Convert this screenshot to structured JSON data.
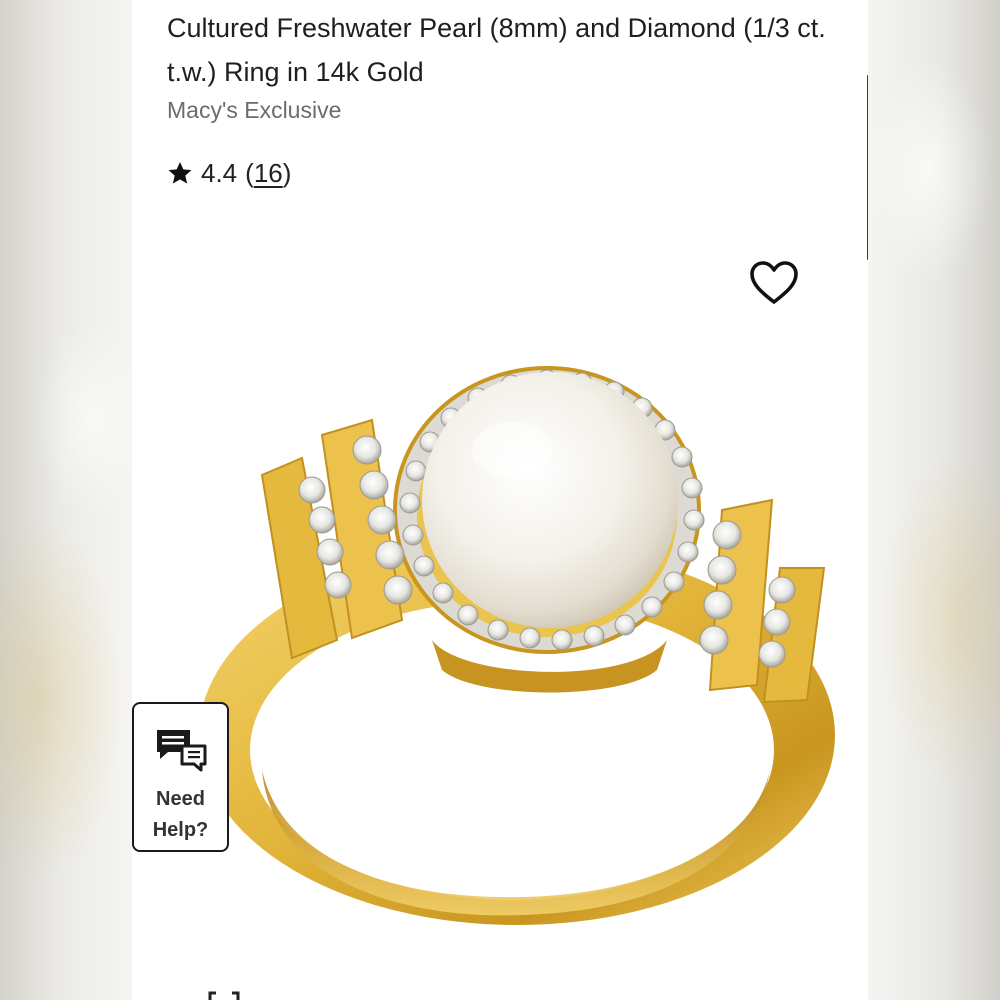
{
  "product": {
    "title": "Cultured Freshwater Pearl (8mm) and Diamond (1/3 ct. t.w.) Ring in 14k Gold",
    "brand": "Macy's Exclusive",
    "rating": {
      "value": "4.4",
      "count": "16",
      "icon": "star-icon"
    },
    "image_alt": "Cultured freshwater pearl and diamond ring in 14k gold"
  },
  "favorite": {
    "icon": "heart-outline-icon"
  },
  "help": {
    "icon": "chat-bubbles-icon",
    "label_line1": "Need",
    "label_line2": "Help?"
  },
  "colors": {
    "gold": "#e2b53a",
    "gold_dark": "#b9861e",
    "pearl": "#f6f3ec",
    "text": "#1f1f1f",
    "muted": "#6c6c6c"
  }
}
